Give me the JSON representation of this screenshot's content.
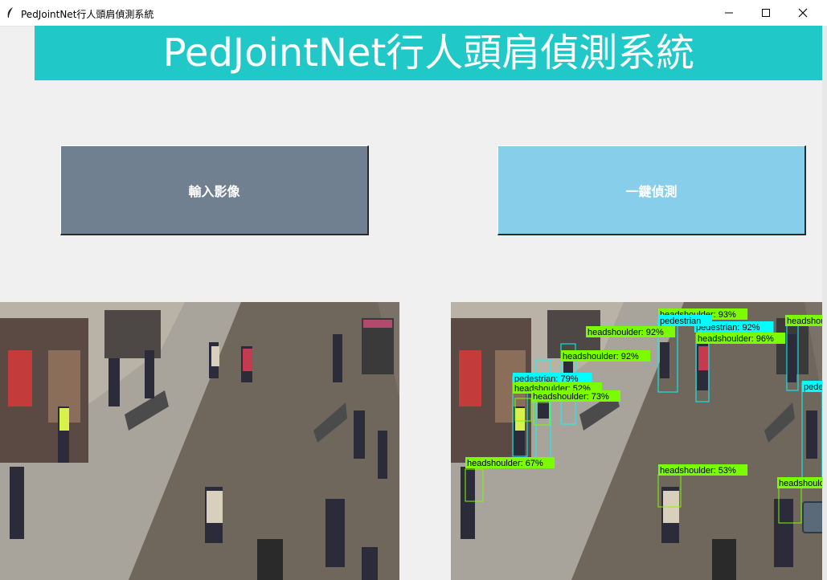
{
  "window": {
    "title": "PedJointNet行人頭肩偵測系統",
    "controls": [
      "minimize",
      "maximize",
      "close"
    ]
  },
  "header": {
    "title": "PedJointNet行人頭肩偵測系統",
    "background": "#20c8c8"
  },
  "buttons": {
    "input_image": {
      "label": "輸入影像",
      "color": "#708090"
    },
    "detect": {
      "label": "一鍵偵測",
      "color": "#87ceeb"
    }
  },
  "detections": [
    {
      "label": "headshoulder: 93%",
      "class": "headshoulder"
    },
    {
      "label": "headshoulder: 92%",
      "class": "headshoulder"
    },
    {
      "label": "pedestrian: 92%",
      "class": "pedestrian"
    },
    {
      "label": "headshoulder: 96%",
      "class": "headshoulder"
    },
    {
      "label": "headshoulder: 92%",
      "class": "headshoulder"
    },
    {
      "label": "pedestrian: 79%",
      "class": "pedestrian"
    },
    {
      "label": "headshoulder: 52%",
      "class": "headshoulder"
    },
    {
      "label": "headshoulder: 73%",
      "class": "headshoulder"
    },
    {
      "label": "headshoulder: 67%",
      "class": "headshoulder"
    },
    {
      "label": "headshoulder: 53%",
      "class": "headshoulder"
    },
    {
      "label": "headshoulde",
      "class": "headshoulder"
    },
    {
      "label": "headshoulde",
      "class": "headshoulder"
    },
    {
      "label": "pedes",
      "class": "pedestrian"
    },
    {
      "label": "pedestrian",
      "class": "pedestrian"
    }
  ],
  "colors": {
    "headshoulder": "#7cfc00",
    "pedestrian": "#00ffff"
  }
}
